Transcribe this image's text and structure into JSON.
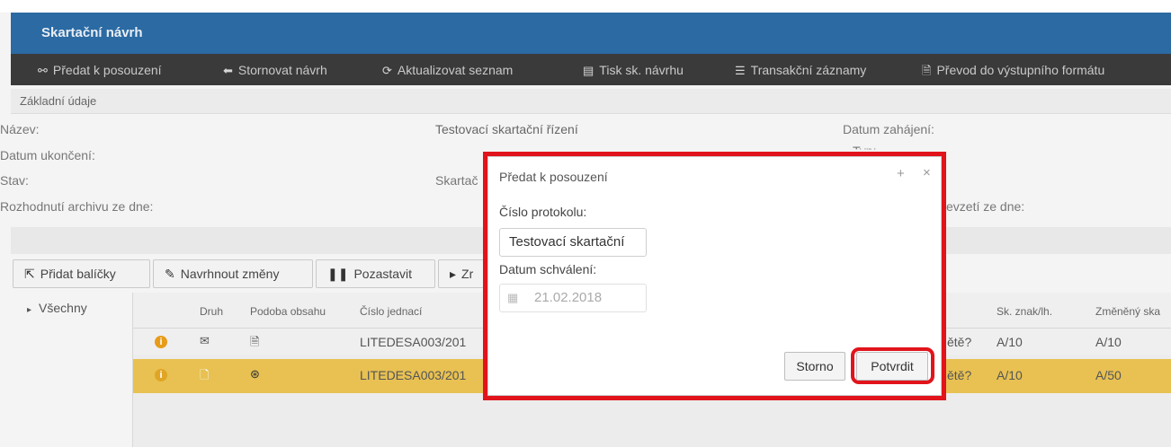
{
  "window": {
    "title": "Skartační návrh"
  },
  "toolbar": [
    {
      "icon": "⚯",
      "label": "Předat k posouzení"
    },
    {
      "icon": "⬅",
      "label": "Stornovat návrh"
    },
    {
      "icon": "⟳",
      "label": "Aktualizovat seznam"
    },
    {
      "icon": "▤",
      "label": "Tisk sk. návrhu"
    },
    {
      "icon": "☰",
      "label": "Transakční záznamy"
    },
    {
      "icon": "🗎",
      "label": "Převod do výstupního formátu"
    }
  ],
  "section": {
    "label": "Základní údaje"
  },
  "fields": {
    "nazev_label": "Název:",
    "nazev_value": "Testovací skartační řízení",
    "datum_zahajeni_label": "Datum zahájení:",
    "datum_ukonceni_label": "Datum ukončení:",
    "typ_label": "Typ:",
    "stav_label": "Stav:",
    "skartac_label": "Skartač",
    "rozhodnuti_label": "Rozhodnutí archivu ze dne:",
    "prevzeti_label": "evzetí ze dne:"
  },
  "actions": [
    {
      "icon": "⇱",
      "label": "Přidat balíčky"
    },
    {
      "icon": "✎",
      "label": "Navrhnout změny"
    },
    {
      "icon": "❚❚",
      "label": "Pozastavit"
    },
    {
      "icon": "▸",
      "label": "Zr"
    }
  ],
  "tree": {
    "root": "Všechny",
    "toggle": "▸"
  },
  "grid": {
    "headers": [
      "Druh",
      "Podoba obsahu",
      "Číslo jednací",
      "Sk. znak/lh.",
      "Změněný ska"
    ],
    "rows": [
      {
        "info": "i",
        "druh": "✉",
        "podoba": "🗎",
        "cislo": "LITEDESA003/201",
        "otazka": "ětě?",
        "znak": "A/10",
        "zmeneny": "A/10"
      },
      {
        "info": "i",
        "druh": "🗋",
        "podoba": "⊛",
        "cislo": "LITEDESA003/201",
        "otazka": "ětě?",
        "znak": "A/10",
        "zmeneny": "A/50"
      }
    ]
  },
  "modal": {
    "title": "Předat k posouzení",
    "pin": "+",
    "close": "×",
    "protocol_label": "Číslo protokolu:",
    "protocol_value": "Testovací skartační",
    "date_label": "Datum schválení:",
    "date_value": "21.02.2018",
    "cancel_label": "Storno",
    "confirm_label": "Potvrdit"
  },
  "colors": {
    "titlebar": "#2b6aa3",
    "toolbar": "#3a3a3a",
    "highlight_row": "#e8c152",
    "annotation": "#e1141c"
  }
}
